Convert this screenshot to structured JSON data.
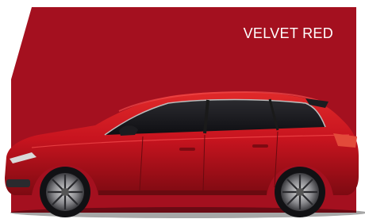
{
  "color_option": {
    "label": "VELVET RED",
    "swatch_color": "#a4101f",
    "car_body_color": "#c8141f",
    "background_color": "#ffffff"
  },
  "images": {
    "car": "car-side-view-image"
  }
}
